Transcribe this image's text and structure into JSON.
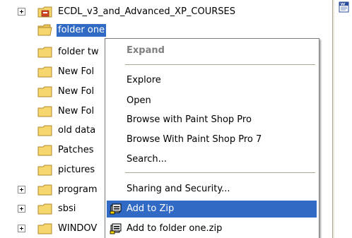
{
  "tree": {
    "items": [
      {
        "label": "ECDL_v3_and_Advanced_XP_COURSES",
        "expandable": true,
        "icon": "special-folder-icon"
      },
      {
        "label": "folder one",
        "expandable": false,
        "selected": true
      },
      {
        "label": "folder tw",
        "expandable": false
      },
      {
        "label": "New Fol",
        "expandable": false
      },
      {
        "label": "New Fol",
        "expandable": false
      },
      {
        "label": "New Fol",
        "expandable": false
      },
      {
        "label": "old data",
        "expandable": false
      },
      {
        "label": "Patches",
        "expandable": false
      },
      {
        "label": "pictures",
        "expandable": false
      },
      {
        "label": "program",
        "expandable": true
      },
      {
        "label": "sbsi",
        "expandable": true
      },
      {
        "label": "WINDOV",
        "expandable": true
      }
    ]
  },
  "context_menu": {
    "expand": "Expand",
    "explore": "Explore",
    "open": "Open",
    "browse_psp": "Browse with Paint Shop Pro",
    "browse_psp7": "Browse With Paint Shop Pro 7",
    "search": "Search...",
    "sharing": "Sharing and Security...",
    "add_to_zip": "Add to Zip",
    "add_to_folder_zip": "Add to folder one.zip"
  },
  "colors": {
    "selection": "#316ac5",
    "folder": "#f5d76e"
  }
}
